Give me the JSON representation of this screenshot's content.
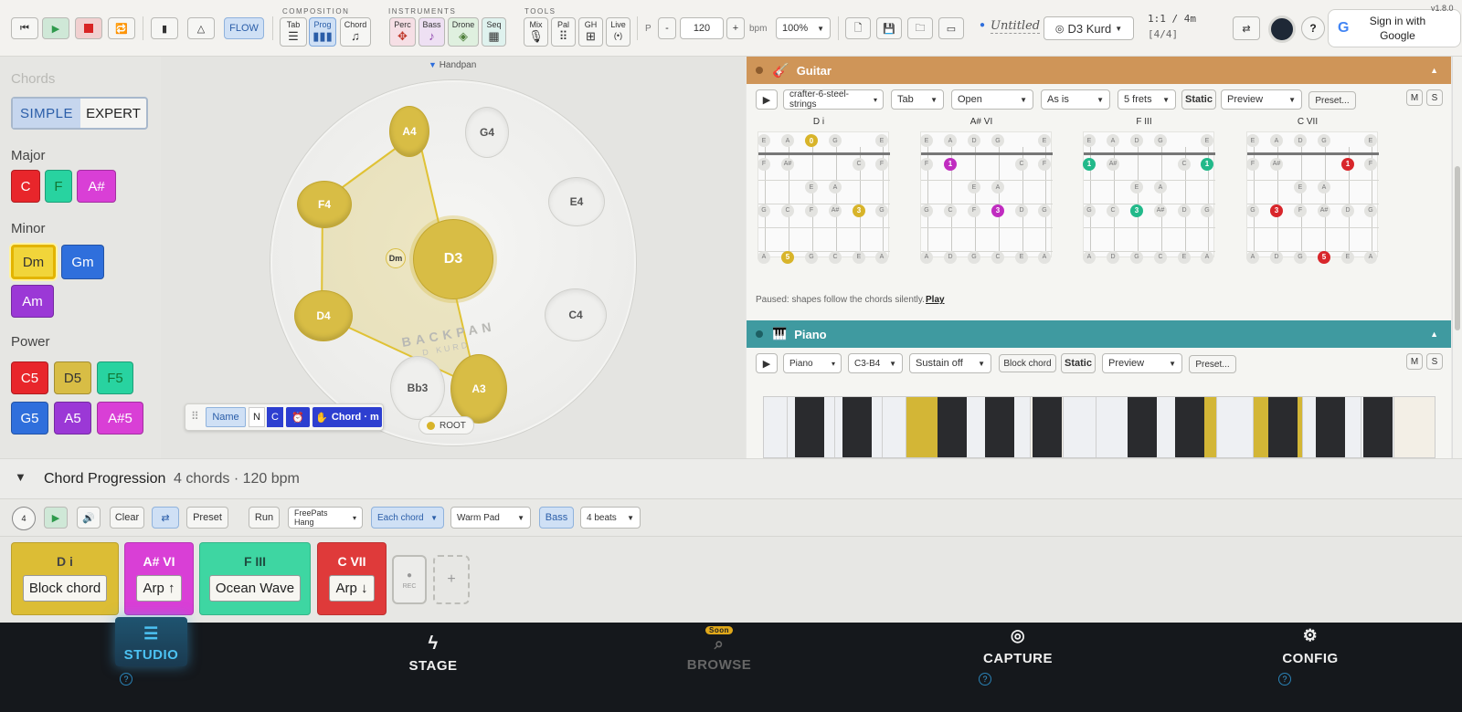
{
  "version": "v1.8.0",
  "toolbar": {
    "flow_label": "FLOW",
    "group_composition": "COMPOSITION",
    "group_instruments": "INSTRUMENTS",
    "group_tools": "TOOLS",
    "composition": [
      {
        "label": "Tab",
        "icon": "tab-icon"
      },
      {
        "label": "Prog",
        "icon": "bars-icon"
      },
      {
        "label": "Chord",
        "icon": "note-icon"
      }
    ],
    "instruments": [
      {
        "label": "Perc",
        "icon": "drum-icon"
      },
      {
        "label": "Bass",
        "icon": "bass-icon"
      },
      {
        "label": "Drone",
        "icon": "drone-icon"
      },
      {
        "label": "Seq",
        "icon": "seq-icon"
      }
    ],
    "tools": [
      {
        "label": "Mix",
        "icon": "mic-icon"
      },
      {
        "label": "Pal",
        "icon": "grid-icon"
      },
      {
        "label": "GH",
        "icon": "gh-icon"
      },
      {
        "label": "Live",
        "icon": "live-icon"
      }
    ],
    "p_label": "P",
    "minus_label": "-",
    "tempo_value": "120",
    "plus_label": "+",
    "bpm_label": "bpm",
    "zoom_value": "100%",
    "song_title": "Untitled",
    "scale_name": "D3 Kurd",
    "position_text": "1:1 / 4m",
    "meter_text": "[4/4]",
    "sign_in_label": "Sign in with Google"
  },
  "left": {
    "panel_title": "Chords",
    "mode_simple": "SIMPLE",
    "mode_expert": "EXPERT",
    "major_label": "Major",
    "major": [
      {
        "label": "C",
        "color": "#e8262b"
      },
      {
        "label": "F",
        "color": "#28d3a0"
      },
      {
        "label": "A#",
        "color": "#d93fd6"
      }
    ],
    "minor_label": "Minor",
    "minor": [
      {
        "label": "Dm",
        "color": "#f1d53a"
      },
      {
        "label": "Gm",
        "color": "#2f6fdc"
      },
      {
        "label": "Am",
        "color": "#9b38d6"
      }
    ],
    "power_label": "Power",
    "power": [
      {
        "label": "C5",
        "color": "#e8262b"
      },
      {
        "label": "D5",
        "color": "#d8bd45"
      },
      {
        "label": "F5",
        "color": "#28d3a0"
      },
      {
        "label": "G5",
        "color": "#2f6fdc"
      },
      {
        "label": "A5",
        "color": "#9b38d6"
      },
      {
        "label": "A#5",
        "color": "#d93fd6"
      }
    ]
  },
  "handpan": {
    "title": "Handpan",
    "center": "D3",
    "chord_tag": "Dm",
    "brand_line1": "BACKPAN",
    "brand_line2": "D KURD",
    "notes": [
      "A4",
      "G4",
      "F4",
      "E4",
      "D4",
      "C4",
      "Bb3",
      "A3"
    ],
    "root_label": "ROOT",
    "controls": {
      "name": "Name",
      "n": "N",
      "c": "C",
      "chord_mode": "Chord · m"
    }
  },
  "guitar": {
    "title": "Guitar",
    "color": "#cf9558",
    "strings_select": "crafter-6-steel-strings",
    "view_select": "Tab",
    "tuning_select": "Open",
    "capo_select": "As is",
    "frets_select": "5 frets",
    "static_label": "Static",
    "preview_select": "Preview",
    "preset_label": "Preset...",
    "m_label": "M",
    "s_label": "S",
    "charts": [
      {
        "name": "D i",
        "color": "#d8b42a",
        "top": [
          "E",
          "A",
          "0",
          "G",
          "",
          "E"
        ],
        "fingers": [
          {
            "label": "0",
            "string": 2,
            "row": 0
          },
          {
            "label": "3",
            "string": 4,
            "row": 3
          },
          {
            "label": "5",
            "string": 1,
            "row": 5
          }
        ],
        "rows": [
          [
            "F",
            "A#",
            "",
            "",
            "C",
            "F"
          ],
          [
            "",
            "",
            "E",
            "A",
            "",
            ""
          ],
          [
            "G",
            "C",
            "F",
            "A#",
            "",
            "G"
          ],
          [
            "",
            "",
            "",
            "",
            "",
            ""
          ],
          [
            "A",
            "",
            "G",
            "C",
            "E",
            "A"
          ]
        ]
      },
      {
        "name": "A# VI",
        "color": "#c02cc0",
        "top": [
          "E",
          "A",
          "D",
          "G",
          "",
          "E"
        ],
        "fingers": [
          {
            "label": "1",
            "string": 1,
            "row": 1
          },
          {
            "label": "3",
            "string": 3,
            "row": 3
          }
        ],
        "rows": [
          [
            "F",
            "",
            "",
            "",
            "C",
            "F"
          ],
          [
            "",
            "",
            "E",
            "A",
            "",
            ""
          ],
          [
            "G",
            "C",
            "F",
            "",
            "D",
            "G"
          ],
          [
            "",
            "",
            "",
            "",
            "",
            ""
          ],
          [
            "A",
            "D",
            "G",
            "C",
            "E",
            "A"
          ]
        ]
      },
      {
        "name": "F III",
        "color": "#22b98a",
        "top": [
          "E",
          "A",
          "D",
          "G",
          "",
          "E"
        ],
        "fingers": [
          {
            "label": "1",
            "string": 0,
            "row": 1
          },
          {
            "label": "1",
            "string": 5,
            "row": 1
          },
          {
            "label": "3",
            "string": 2,
            "row": 3
          }
        ],
        "rows": [
          [
            "",
            "A#",
            "",
            "",
            "C",
            ""
          ],
          [
            "",
            "",
            "E",
            "A",
            "",
            ""
          ],
          [
            "G",
            "C",
            "",
            "A#",
            "D",
            "G"
          ],
          [
            "",
            "",
            "",
            "",
            "",
            ""
          ],
          [
            "A",
            "D",
            "G",
            "C",
            "E",
            "A"
          ]
        ]
      },
      {
        "name": "C VII",
        "color": "#d8262b",
        "top": [
          "E",
          "A",
          "D",
          "G",
          "",
          "E"
        ],
        "fingers": [
          {
            "label": "1",
            "string": 4,
            "row": 1
          },
          {
            "label": "3",
            "string": 1,
            "row": 3
          },
          {
            "label": "5",
            "string": 3,
            "row": 5
          }
        ],
        "rows": [
          [
            "F",
            "A#",
            "",
            "",
            "",
            "F"
          ],
          [
            "",
            "",
            "E",
            "A",
            "",
            ""
          ],
          [
            "G",
            "",
            "F",
            "A#",
            "D",
            "G"
          ],
          [
            "",
            "",
            "",
            "",
            "",
            ""
          ],
          [
            "A",
            "D",
            "G",
            "",
            "E",
            "A"
          ]
        ]
      }
    ],
    "status_text": "Paused: shapes follow the chords silently.",
    "play_link": "Play"
  },
  "piano": {
    "title": "Piano",
    "color": "#3f9aa0",
    "instrument_select": "Piano",
    "range_select": "C3-B4",
    "sustain_select": "Sustain off",
    "block_chord_label": "Block chord",
    "static_label": "Static",
    "preview_select": "Preview",
    "preset_label": "Preset...",
    "m_label": "M",
    "s_label": "S"
  },
  "progression": {
    "title": "Chord Progression",
    "summary": "4 chords · 120 bpm",
    "count_badge": "4",
    "clear_label": "Clear",
    "preset_label": "Preset",
    "run_label": "Run",
    "soundfont_select": "FreePats Hang",
    "each_chord_select": "Each chord",
    "pad_select": "Warm Pad",
    "bass_label": "Bass",
    "beats_select": "4 beats",
    "cards": [
      {
        "title": "D i",
        "pattern": "Block chord",
        "color": "#dcbd35"
      },
      {
        "title": "A# VI",
        "pattern": "Arp ↑",
        "color": "#d93fd6"
      },
      {
        "title": "F III",
        "pattern": "Ocean Wave",
        "color": "#3ed6a2"
      },
      {
        "title": "C VII",
        "pattern": "Arp ↓",
        "color": "#df3a3a"
      }
    ],
    "rec_label": "REC",
    "add_label": "+"
  },
  "nav": {
    "items": [
      {
        "label": "STUDIO",
        "icon": "studio-icon",
        "active": true
      },
      {
        "label": "STAGE",
        "icon": "lightning-icon"
      },
      {
        "label": "BROWSE",
        "icon": "search-icon",
        "badge": "Soon",
        "disabled": true
      },
      {
        "label": "CAPTURE",
        "icon": "target-icon"
      },
      {
        "label": "CONFIG",
        "icon": "gear-icon"
      }
    ]
  }
}
